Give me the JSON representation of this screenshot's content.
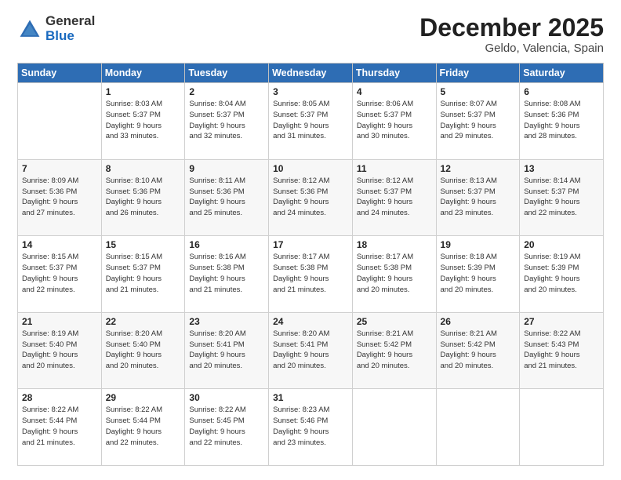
{
  "header": {
    "logo_general": "General",
    "logo_blue": "Blue",
    "title": "December 2025",
    "location": "Geldo, Valencia, Spain"
  },
  "days_of_week": [
    "Sunday",
    "Monday",
    "Tuesday",
    "Wednesday",
    "Thursday",
    "Friday",
    "Saturday"
  ],
  "weeks": [
    [
      {
        "day": "",
        "detail": ""
      },
      {
        "day": "1",
        "detail": "Sunrise: 8:03 AM\nSunset: 5:37 PM\nDaylight: 9 hours\nand 33 minutes."
      },
      {
        "day": "2",
        "detail": "Sunrise: 8:04 AM\nSunset: 5:37 PM\nDaylight: 9 hours\nand 32 minutes."
      },
      {
        "day": "3",
        "detail": "Sunrise: 8:05 AM\nSunset: 5:37 PM\nDaylight: 9 hours\nand 31 minutes."
      },
      {
        "day": "4",
        "detail": "Sunrise: 8:06 AM\nSunset: 5:37 PM\nDaylight: 9 hours\nand 30 minutes."
      },
      {
        "day": "5",
        "detail": "Sunrise: 8:07 AM\nSunset: 5:37 PM\nDaylight: 9 hours\nand 29 minutes."
      },
      {
        "day": "6",
        "detail": "Sunrise: 8:08 AM\nSunset: 5:36 PM\nDaylight: 9 hours\nand 28 minutes."
      }
    ],
    [
      {
        "day": "7",
        "detail": "Sunrise: 8:09 AM\nSunset: 5:36 PM\nDaylight: 9 hours\nand 27 minutes."
      },
      {
        "day": "8",
        "detail": "Sunrise: 8:10 AM\nSunset: 5:36 PM\nDaylight: 9 hours\nand 26 minutes."
      },
      {
        "day": "9",
        "detail": "Sunrise: 8:11 AM\nSunset: 5:36 PM\nDaylight: 9 hours\nand 25 minutes."
      },
      {
        "day": "10",
        "detail": "Sunrise: 8:12 AM\nSunset: 5:36 PM\nDaylight: 9 hours\nand 24 minutes."
      },
      {
        "day": "11",
        "detail": "Sunrise: 8:12 AM\nSunset: 5:37 PM\nDaylight: 9 hours\nand 24 minutes."
      },
      {
        "day": "12",
        "detail": "Sunrise: 8:13 AM\nSunset: 5:37 PM\nDaylight: 9 hours\nand 23 minutes."
      },
      {
        "day": "13",
        "detail": "Sunrise: 8:14 AM\nSunset: 5:37 PM\nDaylight: 9 hours\nand 22 minutes."
      }
    ],
    [
      {
        "day": "14",
        "detail": "Sunrise: 8:15 AM\nSunset: 5:37 PM\nDaylight: 9 hours\nand 22 minutes."
      },
      {
        "day": "15",
        "detail": "Sunrise: 8:15 AM\nSunset: 5:37 PM\nDaylight: 9 hours\nand 21 minutes."
      },
      {
        "day": "16",
        "detail": "Sunrise: 8:16 AM\nSunset: 5:38 PM\nDaylight: 9 hours\nand 21 minutes."
      },
      {
        "day": "17",
        "detail": "Sunrise: 8:17 AM\nSunset: 5:38 PM\nDaylight: 9 hours\nand 21 minutes."
      },
      {
        "day": "18",
        "detail": "Sunrise: 8:17 AM\nSunset: 5:38 PM\nDaylight: 9 hours\nand 20 minutes."
      },
      {
        "day": "19",
        "detail": "Sunrise: 8:18 AM\nSunset: 5:39 PM\nDaylight: 9 hours\nand 20 minutes."
      },
      {
        "day": "20",
        "detail": "Sunrise: 8:19 AM\nSunset: 5:39 PM\nDaylight: 9 hours\nand 20 minutes."
      }
    ],
    [
      {
        "day": "21",
        "detail": "Sunrise: 8:19 AM\nSunset: 5:40 PM\nDaylight: 9 hours\nand 20 minutes."
      },
      {
        "day": "22",
        "detail": "Sunrise: 8:20 AM\nSunset: 5:40 PM\nDaylight: 9 hours\nand 20 minutes."
      },
      {
        "day": "23",
        "detail": "Sunrise: 8:20 AM\nSunset: 5:41 PM\nDaylight: 9 hours\nand 20 minutes."
      },
      {
        "day": "24",
        "detail": "Sunrise: 8:20 AM\nSunset: 5:41 PM\nDaylight: 9 hours\nand 20 minutes."
      },
      {
        "day": "25",
        "detail": "Sunrise: 8:21 AM\nSunset: 5:42 PM\nDaylight: 9 hours\nand 20 minutes."
      },
      {
        "day": "26",
        "detail": "Sunrise: 8:21 AM\nSunset: 5:42 PM\nDaylight: 9 hours\nand 20 minutes."
      },
      {
        "day": "27",
        "detail": "Sunrise: 8:22 AM\nSunset: 5:43 PM\nDaylight: 9 hours\nand 21 minutes."
      }
    ],
    [
      {
        "day": "28",
        "detail": "Sunrise: 8:22 AM\nSunset: 5:44 PM\nDaylight: 9 hours\nand 21 minutes."
      },
      {
        "day": "29",
        "detail": "Sunrise: 8:22 AM\nSunset: 5:44 PM\nDaylight: 9 hours\nand 22 minutes."
      },
      {
        "day": "30",
        "detail": "Sunrise: 8:22 AM\nSunset: 5:45 PM\nDaylight: 9 hours\nand 22 minutes."
      },
      {
        "day": "31",
        "detail": "Sunrise: 8:23 AM\nSunset: 5:46 PM\nDaylight: 9 hours\nand 23 minutes."
      },
      {
        "day": "",
        "detail": ""
      },
      {
        "day": "",
        "detail": ""
      },
      {
        "day": "",
        "detail": ""
      }
    ]
  ]
}
